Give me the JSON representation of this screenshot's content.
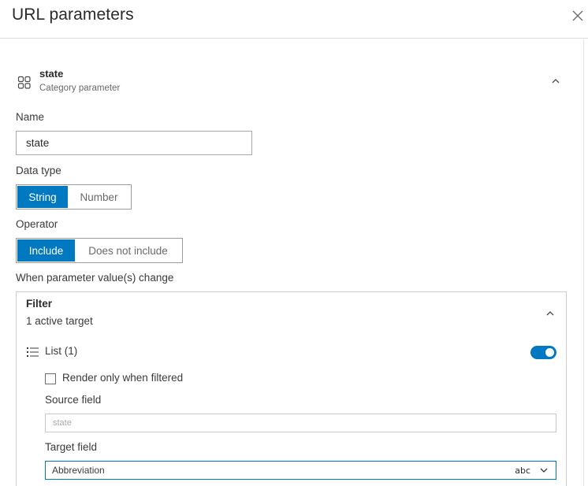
{
  "panel": {
    "title": "URL parameters"
  },
  "parameter": {
    "name": "state",
    "type": "Category parameter",
    "icon": "category-grid-icon"
  },
  "form": {
    "name_label": "Name",
    "name_value": "state",
    "data_type_label": "Data type",
    "data_type_options": [
      "String",
      "Number"
    ],
    "data_type_selected": "String",
    "operator_label": "Operator",
    "operator_options": [
      "Include",
      "Does not include"
    ],
    "operator_selected": "Include",
    "change_label": "When parameter value(s) change"
  },
  "filter": {
    "title": "Filter",
    "subtitle": "1 active target",
    "target": {
      "label": "List (1)",
      "enabled": true,
      "render_only_label": "Render only when filtered",
      "render_only_checked": false,
      "source_field_label": "Source field",
      "source_field_placeholder": "state",
      "target_field_label": "Target field",
      "target_field_value": "Abbreviation",
      "target_field_type": "abc"
    }
  },
  "colors": {
    "accent": "#0079c1"
  }
}
